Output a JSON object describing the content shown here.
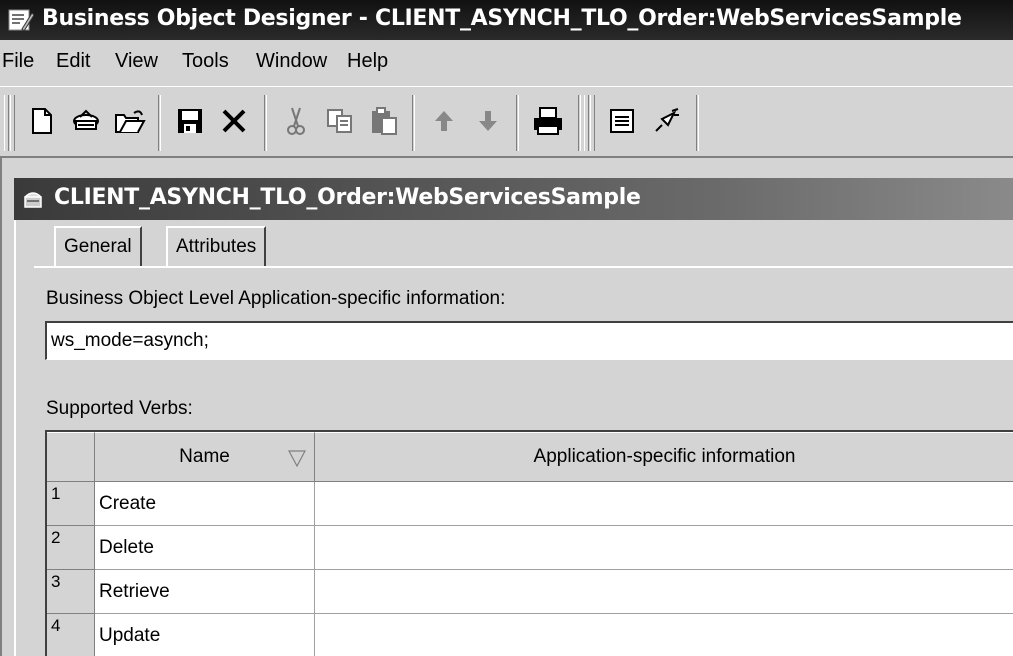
{
  "window": {
    "title": "Business Object Designer - CLIENT_ASYNCH_TLO_Order:WebServicesSample"
  },
  "menu": [
    "File",
    "Edit",
    "View",
    "Tools",
    "Window",
    "Help"
  ],
  "toolbar": {
    "buttons": [
      "new-icon",
      "open-server-icon",
      "open-file-icon",
      "save-icon",
      "delete-icon",
      "cut-icon",
      "copy-icon",
      "paste-icon",
      "move-up-icon",
      "move-down-icon",
      "print-icon",
      "properties-icon",
      "connect-icon"
    ]
  },
  "inner_window": {
    "title": "CLIENT_ASYNCH_TLO_Order:WebServicesSample",
    "tabs": [
      "General",
      "Attributes"
    ],
    "active_tab": "General"
  },
  "form": {
    "bo_asi_label": "Business Object Level Application-specific information:",
    "bo_asi_value": "ws_mode=asynch;",
    "verbs_label": "Supported Verbs:"
  },
  "verbs_table": {
    "columns": [
      "Name",
      "Application-specific information"
    ],
    "rows": [
      {
        "num": "1",
        "name": "Create",
        "asi": ""
      },
      {
        "num": "2",
        "name": "Delete",
        "asi": ""
      },
      {
        "num": "3",
        "name": "Retrieve",
        "asi": ""
      },
      {
        "num": "4",
        "name": "Update",
        "asi": ""
      }
    ]
  }
}
